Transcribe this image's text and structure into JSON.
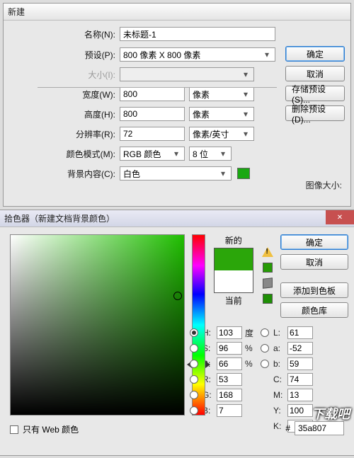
{
  "new_dialog": {
    "title": "新建",
    "name_label": "名称(N):",
    "name_value": "未标题-1",
    "preset_label": "预设(P):",
    "preset_value": "800 像素 X 800 像素",
    "size_label": "大小(I):",
    "size_value": "",
    "width_label": "宽度(W):",
    "width_value": "800",
    "width_unit": "像素",
    "height_label": "高度(H):",
    "height_value": "800",
    "height_unit": "像素",
    "res_label": "分辨率(R):",
    "res_value": "72",
    "res_unit": "像素/英寸",
    "mode_label": "颜色模式(M):",
    "mode_value": "RGB 颜色",
    "depth_value": "8 位",
    "bg_label": "背景内容(C):",
    "bg_value": "白色",
    "bg_swatch": "#1aa812",
    "ok": "确定",
    "cancel": "取消",
    "save_preset": "存储预设(S)...",
    "delete_preset": "删除预设(D)...",
    "image_size_label": "图像大小:"
  },
  "picker": {
    "title": "拾色器（新建文档背景颜色）",
    "new_label": "新的",
    "current_label": "当前",
    "new_color": "#2BA60A",
    "current_color": "#ffffff",
    "warn_swatch": "#269b05",
    "cube_swatch": "#1e8f05",
    "ok": "确定",
    "cancel": "取消",
    "add_swatch": "添加到色板",
    "lib": "颜色库",
    "sv_cursor": {
      "x_pct": 96,
      "y_pct": 34
    },
    "hue_cursor_pct": 70,
    "fields": {
      "H": {
        "label": "H:",
        "value": "103",
        "unit": "度"
      },
      "S": {
        "label": "S:",
        "value": "96",
        "unit": "%"
      },
      "Bv": {
        "label": "B:",
        "value": "66",
        "unit": "%"
      },
      "R": {
        "label": "R:",
        "value": "53",
        "unit": ""
      },
      "G": {
        "label": "G:",
        "value": "168",
        "unit": ""
      },
      "Bc": {
        "label": "B:",
        "value": "7",
        "unit": ""
      },
      "L": {
        "label": "L:",
        "value": "61",
        "unit": ""
      },
      "a": {
        "label": "a:",
        "value": "-52",
        "unit": ""
      },
      "b": {
        "label": "b:",
        "value": "59",
        "unit": ""
      },
      "C": {
        "label": "C:",
        "value": "74",
        "unit": ""
      },
      "M": {
        "label": "M:",
        "value": "13",
        "unit": ""
      },
      "Y": {
        "label": "Y:",
        "value": "100",
        "unit": ""
      },
      "K": {
        "label": "K:",
        "value": "",
        "unit": ""
      }
    },
    "selected_radio": "H",
    "hex_label": "#",
    "hex_value": "35a807",
    "web_only_label": "只有 Web 颜色",
    "watermark": "下载吧"
  }
}
